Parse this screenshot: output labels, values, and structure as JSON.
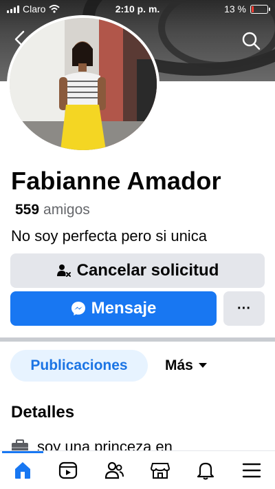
{
  "status_bar": {
    "carrier": "Claro",
    "time": "2:10 p. m.",
    "battery": "13 %",
    "battery_level": 0.13
  },
  "profile": {
    "name": "Fabianne Amador",
    "friends_count": "559",
    "friends_label": "amigos",
    "bio": "No soy perfecta pero si unica"
  },
  "actions": {
    "cancel_request": "Cancelar solicitud",
    "message": "Mensaje",
    "more": "···"
  },
  "tabs": {
    "posts": "Publicaciones",
    "more": "Más"
  },
  "details": {
    "title": "Detalles",
    "items": [
      {
        "icon": "briefcase-icon",
        "text": "soy una princeza en"
      }
    ]
  },
  "bottom_nav": {
    "items": [
      "home-icon",
      "video-icon",
      "friends-icon",
      "marketplace-icon",
      "bell-icon",
      "menu-icon"
    ],
    "active": 0
  },
  "colors": {
    "accent": "#1877f2",
    "accent_light": "#e7f3ff",
    "secondary_button": "#e4e6eb",
    "muted_text": "#65676b"
  }
}
